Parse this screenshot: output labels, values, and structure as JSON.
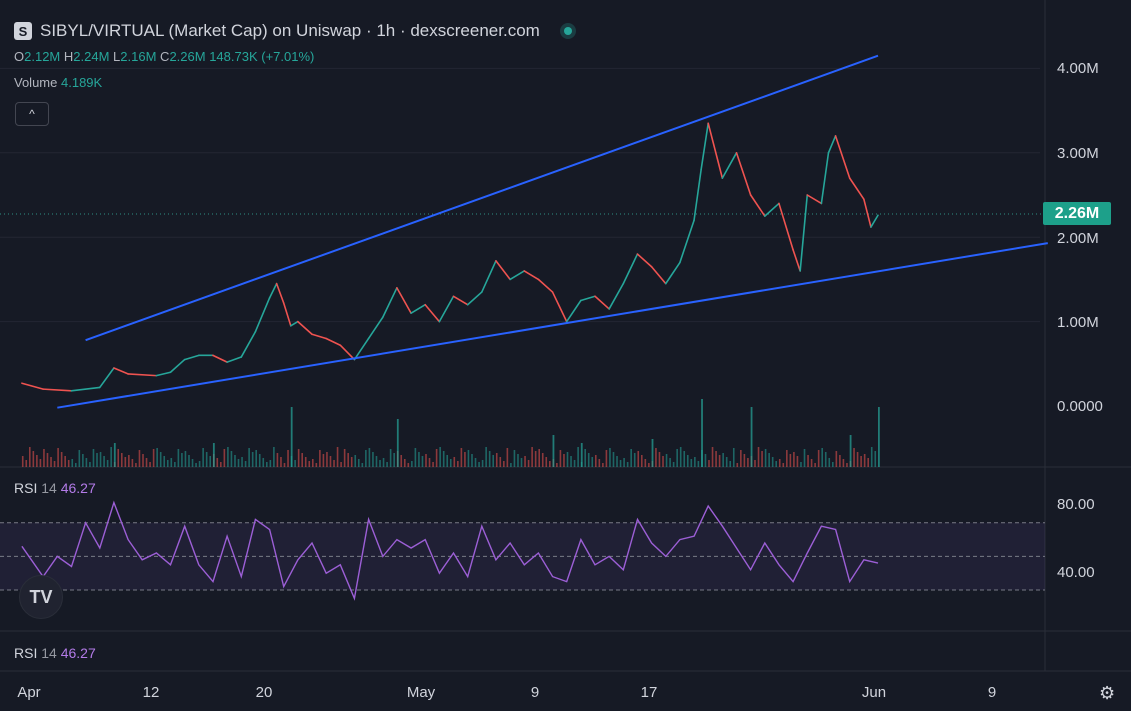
{
  "header": {
    "symbol_badge": "S",
    "title": "SIBYL/VIRTUAL (Market Cap) on Uniswap · 1h · dexscreener.com",
    "ohlc": [
      {
        "key": "O",
        "value": "2.12M"
      },
      {
        "key": "H",
        "value": "2.24M"
      },
      {
        "key": "L",
        "value": "2.16M"
      },
      {
        "key": "C",
        "value": "2.26M"
      },
      {
        "key": "",
        "value": "148.73K (+7.01%)"
      }
    ],
    "volume_label": "Volume",
    "volume_value": "4.189K",
    "collapse_icon": "chevron-up-icon",
    "collapse_glyph": "^"
  },
  "rsi_legend": {
    "key": "RSI",
    "length": "14",
    "value": "46.27"
  },
  "rsi_legend_bottom": {
    "key": "RSI",
    "length": "14",
    "value": "46.27"
  },
  "price_axis": [
    "4.00M",
    "3.00M",
    "2.00M",
    "1.00M",
    "0.0000"
  ],
  "last_price": "2.26M",
  "rsi_axis": [
    "80.00",
    "40.00"
  ],
  "time_axis": [
    "Apr",
    "12",
    "20",
    "May",
    "9",
    "17",
    "Jun",
    "9"
  ],
  "logo_text": "TV",
  "settings_icon": "gear-icon",
  "colors": {
    "background": "#161a25",
    "up": "#26a69a",
    "down": "#ef5350",
    "trendline": "#2962ff",
    "rsi": "#9c5fd6",
    "rsi_band": "#7e57c2",
    "badge": "#1da08a"
  },
  "chart_data": [
    {
      "type": "line",
      "title": "SIBYL/VIRTUAL (Market Cap) on Uniswap · 1h",
      "ylabel": "Market Cap",
      "ylim": [
        0,
        4.4
      ],
      "y_unit": "M",
      "timeline_start": "Apr 1",
      "timeline_end": "Jun 12",
      "x_ticks": [
        {
          "label": "Apr",
          "day": 1
        },
        {
          "label": "12",
          "day": 12
        },
        {
          "label": "20",
          "day": 20
        },
        {
          "label": "May",
          "day": 31
        },
        {
          "label": "9",
          "day": 39
        },
        {
          "label": "17",
          "day": 47
        },
        {
          "label": "Jun",
          "day": 62
        },
        {
          "label": "9",
          "day": 70
        }
      ],
      "series": [
        {
          "name": "SIBYL/VIRTUAL",
          "points": [
            [
              0.5,
              0.27
            ],
            [
              2,
              0.2
            ],
            [
              4,
              0.18
            ],
            [
              6,
              0.22
            ],
            [
              7,
              0.45
            ],
            [
              8,
              0.38
            ],
            [
              10,
              0.36
            ],
            [
              11,
              0.4
            ],
            [
              12,
              0.55
            ],
            [
              13,
              0.6
            ],
            [
              14,
              0.6
            ],
            [
              15,
              0.52
            ],
            [
              16,
              0.58
            ],
            [
              17,
              0.88
            ],
            [
              18,
              1.28
            ],
            [
              18.5,
              1.45
            ],
            [
              19,
              1.22
            ],
            [
              19.5,
              0.95
            ],
            [
              20,
              1.0
            ],
            [
              21,
              0.85
            ],
            [
              22,
              0.8
            ],
            [
              23,
              0.72
            ],
            [
              24,
              0.55
            ],
            [
              25,
              0.8
            ],
            [
              26,
              1.05
            ],
            [
              27,
              1.4
            ],
            [
              28,
              1.1
            ],
            [
              29,
              1.2
            ],
            [
              30,
              1.0
            ],
            [
              31,
              1.3
            ],
            [
              32,
              1.2
            ],
            [
              33,
              1.35
            ],
            [
              34,
              1.72
            ],
            [
              35,
              1.5
            ],
            [
              36,
              1.6
            ],
            [
              37,
              1.5
            ],
            [
              38,
              1.35
            ],
            [
              39,
              1.0
            ],
            [
              40,
              1.25
            ],
            [
              41,
              1.3
            ],
            [
              42,
              1.15
            ],
            [
              43,
              1.45
            ],
            [
              44,
              1.8
            ],
            [
              45,
              1.65
            ],
            [
              46,
              1.45
            ],
            [
              47,
              1.7
            ],
            [
              48,
              2.2
            ],
            [
              48.5,
              2.8
            ],
            [
              49,
              3.35
            ],
            [
              50,
              2.7
            ],
            [
              51,
              3.0
            ],
            [
              52,
              2.5
            ],
            [
              53,
              2.25
            ],
            [
              54,
              2.4
            ],
            [
              55,
              1.85
            ],
            [
              55.5,
              1.6
            ],
            [
              56,
              2.5
            ],
            [
              57,
              2.4
            ],
            [
              57.5,
              3.0
            ],
            [
              58,
              3.2
            ],
            [
              59,
              2.7
            ],
            [
              60,
              2.45
            ],
            [
              60.5,
              2.12
            ],
            [
              61,
              2.26
            ]
          ]
        },
        {
          "name": "Volume",
          "spikes": [
            [
              7,
              0.3
            ],
            [
              14,
              0.3
            ],
            [
              19.5,
              0.75
            ],
            [
              27,
              0.6
            ],
            [
              38,
              0.4
            ],
            [
              40,
              0.3
            ],
            [
              45,
              0.35
            ],
            [
              48.5,
              0.85
            ],
            [
              52,
              0.75
            ],
            [
              59,
              0.4
            ],
            [
              61,
              0.75
            ]
          ]
        }
      ],
      "trendlines": [
        {
          "from": [
            5,
            0.78
          ],
          "to": [
            61,
            4.15
          ]
        },
        {
          "from": [
            3,
            -0.02
          ],
          "to": [
            73,
            1.93
          ]
        }
      ]
    },
    {
      "type": "line",
      "title": "RSI 14",
      "ylim": [
        20,
        85
      ],
      "reference_lines": [
        70,
        50,
        30
      ],
      "series": [
        {
          "name": "RSI",
          "points": [
            [
              0.5,
              56
            ],
            [
              2,
              38
            ],
            [
              3,
              50
            ],
            [
              4,
              44
            ],
            [
              5,
              70
            ],
            [
              6,
              55
            ],
            [
              7,
              82
            ],
            [
              8,
              60
            ],
            [
              9,
              48
            ],
            [
              10,
              52
            ],
            [
              11,
              45
            ],
            [
              12,
              68
            ],
            [
              13,
              45
            ],
            [
              14,
              35
            ],
            [
              15,
              62
            ],
            [
              16,
              38
            ],
            [
              17,
              72
            ],
            [
              18,
              66
            ],
            [
              19,
              32
            ],
            [
              20,
              48
            ],
            [
              21,
              58
            ],
            [
              22,
              40
            ],
            [
              23,
              45
            ],
            [
              24,
              25
            ],
            [
              25,
              72
            ],
            [
              26,
              50
            ],
            [
              27,
              60
            ],
            [
              28,
              55
            ],
            [
              29,
              60
            ],
            [
              30,
              40
            ],
            [
              31,
              52
            ],
            [
              32,
              38
            ],
            [
              33,
              68
            ],
            [
              34,
              48
            ],
            [
              35,
              58
            ],
            [
              36,
              45
            ],
            [
              37,
              52
            ],
            [
              38,
              38
            ],
            [
              39,
              35
            ],
            [
              40,
              60
            ],
            [
              41,
              45
            ],
            [
              42,
              50
            ],
            [
              43,
              42
            ],
            [
              44,
              72
            ],
            [
              45,
              58
            ],
            [
              46,
              50
            ],
            [
              47,
              60
            ],
            [
              48,
              62
            ],
            [
              49,
              80
            ],
            [
              50,
              68
            ],
            [
              51,
              55
            ],
            [
              52,
              42
            ],
            [
              53,
              58
            ],
            [
              54,
              45
            ],
            [
              55,
              35
            ],
            [
              56,
              52
            ],
            [
              57,
              68
            ],
            [
              58,
              66
            ],
            [
              59,
              35
            ],
            [
              60,
              48
            ],
            [
              61,
              46
            ]
          ]
        }
      ]
    }
  ]
}
